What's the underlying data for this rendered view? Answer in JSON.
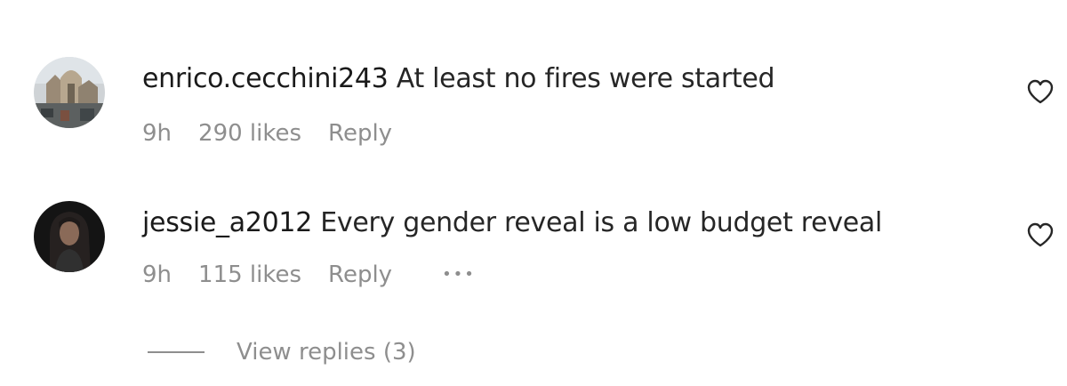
{
  "comments": [
    {
      "username": "enrico.cecchini243",
      "text": "At least no fires were started",
      "time": "9h",
      "likes": "290 likes",
      "reply_label": "Reply",
      "avatar_icon": "avatar-photo-cathedral",
      "like_icon": "heart-outline-icon"
    },
    {
      "username": "jessie_a2012",
      "text": "Every gender reveal is a low budget reveal",
      "time": "9h",
      "likes": "115 likes",
      "reply_label": "Reply",
      "more_label": "•••",
      "avatar_icon": "avatar-photo-person",
      "like_icon": "heart-outline-icon"
    }
  ],
  "view_replies_label": "View replies (3)",
  "colors": {
    "primary_text": "#262626",
    "secondary_text": "#8e8e8e",
    "background": "#ffffff"
  }
}
